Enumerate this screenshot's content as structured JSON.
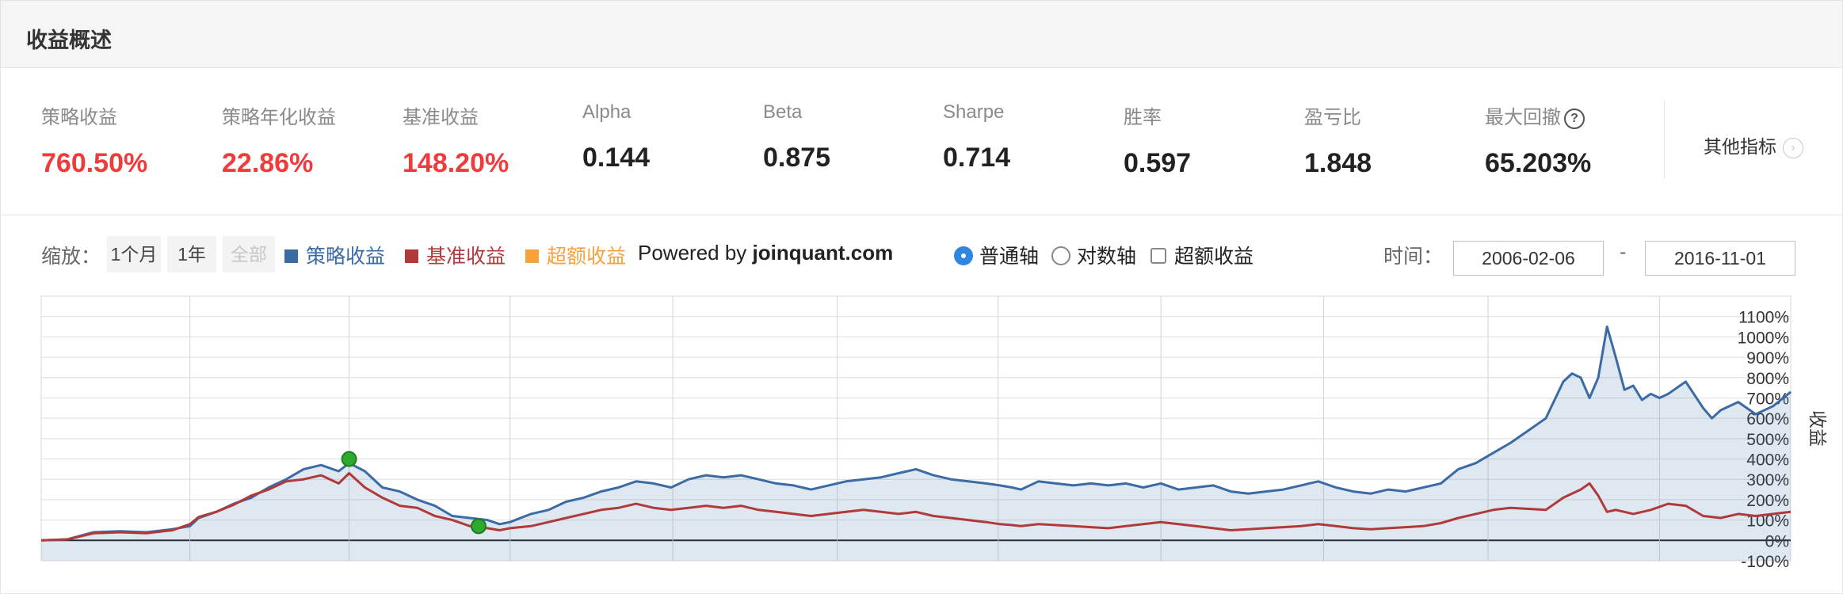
{
  "header": {
    "title": "收益概述"
  },
  "stats": [
    {
      "label": "策略收益",
      "value": "760.50%",
      "color": "red"
    },
    {
      "label": "策略年化收益",
      "value": "22.86%",
      "color": "red"
    },
    {
      "label": "基准收益",
      "value": "148.20%",
      "color": "red"
    },
    {
      "label": "Alpha",
      "value": "0.144",
      "color": "dark"
    },
    {
      "label": "Beta",
      "value": "0.875",
      "color": "dark"
    },
    {
      "label": "Sharpe",
      "value": "0.714",
      "color": "dark"
    },
    {
      "label": "胜率",
      "value": "0.597",
      "color": "dark"
    },
    {
      "label": "盈亏比",
      "value": "1.848",
      "color": "dark"
    },
    {
      "label": "最大回撤",
      "value": "65.203%",
      "color": "dark",
      "icon": "question-icon"
    }
  ],
  "more_metrics": {
    "label": "其他指标",
    "icon": "chevron-right-icon"
  },
  "toolbar": {
    "zoom_label": "缩放：",
    "zoom_buttons": [
      {
        "label": "1个月",
        "enabled": true
      },
      {
        "label": "1年",
        "enabled": true
      },
      {
        "label": "全部",
        "enabled": false
      }
    ],
    "legend": [
      {
        "label": "策略收益",
        "color": "#3b6ba5"
      },
      {
        "label": "基准收益",
        "color": "#b03a3a"
      },
      {
        "label": "超额收益",
        "color": "#f7a13a"
      }
    ],
    "powered_prefix": "Powered by",
    "powered_site": "joinquant.com",
    "axis_options": [
      {
        "label": "普通轴",
        "type": "radio",
        "checked": true
      },
      {
        "label": "对数轴",
        "type": "radio",
        "checked": false
      },
      {
        "label": "超额收益",
        "type": "checkbox",
        "checked": false
      }
    ],
    "time_label": "时间：",
    "date_from": "2006-02-06",
    "date_separator": "-",
    "date_to": "2016-11-01"
  },
  "chart_data": {
    "type": "area",
    "x_range": [
      "2006-02-06",
      "2016-11-01"
    ],
    "ylabel": "收益",
    "y_ticks": [
      "1100%",
      "1000%",
      "900%",
      "800%",
      "700%",
      "600%",
      "500%",
      "400%",
      "300%",
      "200%",
      "100%",
      "0%",
      "-100%"
    ],
    "ylim": [
      -100,
      1200
    ],
    "grid": true,
    "x_markers": [
      0.085,
      0.176,
      0.268,
      0.361,
      0.455,
      0.547,
      0.64,
      0.733,
      0.827,
      0.925
    ],
    "series": [
      {
        "name": "策略收益",
        "color": "#3b6ba5",
        "fill": true,
        "points": [
          [
            0,
            0
          ],
          [
            0.015,
            5
          ],
          [
            0.03,
            40
          ],
          [
            0.045,
            45
          ],
          [
            0.06,
            40
          ],
          [
            0.075,
            55
          ],
          [
            0.085,
            70
          ],
          [
            0.09,
            110
          ],
          [
            0.1,
            140
          ],
          [
            0.11,
            180
          ],
          [
            0.12,
            210
          ],
          [
            0.13,
            260
          ],
          [
            0.14,
            300
          ],
          [
            0.15,
            350
          ],
          [
            0.16,
            370
          ],
          [
            0.17,
            340
          ],
          [
            0.176,
            380
          ],
          [
            0.185,
            340
          ],
          [
            0.195,
            260
          ],
          [
            0.205,
            240
          ],
          [
            0.215,
            200
          ],
          [
            0.225,
            170
          ],
          [
            0.235,
            120
          ],
          [
            0.245,
            110
          ],
          [
            0.255,
            100
          ],
          [
            0.262,
            80
          ],
          [
            0.268,
            90
          ],
          [
            0.28,
            130
          ],
          [
            0.29,
            150
          ],
          [
            0.3,
            190
          ],
          [
            0.31,
            210
          ],
          [
            0.32,
            240
          ],
          [
            0.33,
            260
          ],
          [
            0.34,
            290
          ],
          [
            0.35,
            280
          ],
          [
            0.36,
            260
          ],
          [
            0.37,
            300
          ],
          [
            0.38,
            320
          ],
          [
            0.39,
            310
          ],
          [
            0.4,
            320
          ],
          [
            0.41,
            300
          ],
          [
            0.42,
            280
          ],
          [
            0.43,
            270
          ],
          [
            0.44,
            250
          ],
          [
            0.45,
            270
          ],
          [
            0.46,
            290
          ],
          [
            0.47,
            300
          ],
          [
            0.48,
            310
          ],
          [
            0.49,
            330
          ],
          [
            0.5,
            350
          ],
          [
            0.51,
            320
          ],
          [
            0.52,
            300
          ],
          [
            0.53,
            290
          ],
          [
            0.54,
            280
          ],
          [
            0.548,
            270
          ],
          [
            0.555,
            260
          ],
          [
            0.56,
            250
          ],
          [
            0.57,
            290
          ],
          [
            0.58,
            280
          ],
          [
            0.59,
            270
          ],
          [
            0.6,
            280
          ],
          [
            0.61,
            270
          ],
          [
            0.62,
            280
          ],
          [
            0.63,
            260
          ],
          [
            0.64,
            280
          ],
          [
            0.65,
            250
          ],
          [
            0.66,
            260
          ],
          [
            0.67,
            270
          ],
          [
            0.68,
            240
          ],
          [
            0.69,
            230
          ],
          [
            0.7,
            240
          ],
          [
            0.71,
            250
          ],
          [
            0.72,
            270
          ],
          [
            0.73,
            290
          ],
          [
            0.74,
            260
          ],
          [
            0.75,
            240
          ],
          [
            0.76,
            230
          ],
          [
            0.77,
            250
          ],
          [
            0.78,
            240
          ],
          [
            0.79,
            260
          ],
          [
            0.8,
            280
          ],
          [
            0.81,
            350
          ],
          [
            0.82,
            380
          ],
          [
            0.83,
            430
          ],
          [
            0.84,
            480
          ],
          [
            0.85,
            540
          ],
          [
            0.86,
            600
          ],
          [
            0.87,
            780
          ],
          [
            0.875,
            820
          ],
          [
            0.88,
            800
          ],
          [
            0.885,
            700
          ],
          [
            0.89,
            800
          ],
          [
            0.895,
            1050
          ],
          [
            0.9,
            900
          ],
          [
            0.905,
            740
          ],
          [
            0.91,
            760
          ],
          [
            0.915,
            690
          ],
          [
            0.92,
            720
          ],
          [
            0.925,
            700
          ],
          [
            0.93,
            720
          ],
          [
            0.94,
            780
          ],
          [
            0.95,
            650
          ],
          [
            0.955,
            600
          ],
          [
            0.96,
            640
          ],
          [
            0.97,
            680
          ],
          [
            0.98,
            620
          ],
          [
            0.99,
            660
          ],
          [
            1.0,
            730
          ]
        ]
      },
      {
        "name": "基准收益",
        "color": "#b03a3a",
        "fill": false,
        "points": [
          [
            0,
            0
          ],
          [
            0.015,
            5
          ],
          [
            0.03,
            35
          ],
          [
            0.045,
            40
          ],
          [
            0.06,
            35
          ],
          [
            0.075,
            50
          ],
          [
            0.085,
            80
          ],
          [
            0.09,
            115
          ],
          [
            0.1,
            140
          ],
          [
            0.11,
            175
          ],
          [
            0.12,
            220
          ],
          [
            0.13,
            250
          ],
          [
            0.14,
            290
          ],
          [
            0.15,
            300
          ],
          [
            0.16,
            320
          ],
          [
            0.17,
            280
          ],
          [
            0.176,
            330
          ],
          [
            0.185,
            260
          ],
          [
            0.195,
            210
          ],
          [
            0.205,
            170
          ],
          [
            0.215,
            160
          ],
          [
            0.225,
            120
          ],
          [
            0.235,
            100
          ],
          [
            0.245,
            70
          ],
          [
            0.255,
            60
          ],
          [
            0.262,
            50
          ],
          [
            0.268,
            60
          ],
          [
            0.28,
            70
          ],
          [
            0.29,
            90
          ],
          [
            0.3,
            110
          ],
          [
            0.31,
            130
          ],
          [
            0.32,
            150
          ],
          [
            0.33,
            160
          ],
          [
            0.34,
            180
          ],
          [
            0.35,
            160
          ],
          [
            0.36,
            150
          ],
          [
            0.37,
            160
          ],
          [
            0.38,
            170
          ],
          [
            0.39,
            160
          ],
          [
            0.4,
            170
          ],
          [
            0.41,
            150
          ],
          [
            0.42,
            140
          ],
          [
            0.43,
            130
          ],
          [
            0.44,
            120
          ],
          [
            0.45,
            130
          ],
          [
            0.46,
            140
          ],
          [
            0.47,
            150
          ],
          [
            0.48,
            140
          ],
          [
            0.49,
            130
          ],
          [
            0.5,
            140
          ],
          [
            0.51,
            120
          ],
          [
            0.52,
            110
          ],
          [
            0.53,
            100
          ],
          [
            0.54,
            90
          ],
          [
            0.548,
            80
          ],
          [
            0.555,
            75
          ],
          [
            0.56,
            70
          ],
          [
            0.57,
            80
          ],
          [
            0.58,
            75
          ],
          [
            0.59,
            70
          ],
          [
            0.6,
            65
          ],
          [
            0.61,
            60
          ],
          [
            0.62,
            70
          ],
          [
            0.63,
            80
          ],
          [
            0.64,
            90
          ],
          [
            0.65,
            80
          ],
          [
            0.66,
            70
          ],
          [
            0.67,
            60
          ],
          [
            0.68,
            50
          ],
          [
            0.69,
            55
          ],
          [
            0.7,
            60
          ],
          [
            0.71,
            65
          ],
          [
            0.72,
            70
          ],
          [
            0.73,
            80
          ],
          [
            0.74,
            70
          ],
          [
            0.75,
            60
          ],
          [
            0.76,
            55
          ],
          [
            0.77,
            60
          ],
          [
            0.78,
            65
          ],
          [
            0.79,
            70
          ],
          [
            0.8,
            85
          ],
          [
            0.81,
            110
          ],
          [
            0.82,
            130
          ],
          [
            0.83,
            150
          ],
          [
            0.84,
            160
          ],
          [
            0.85,
            155
          ],
          [
            0.86,
            150
          ],
          [
            0.87,
            210
          ],
          [
            0.88,
            250
          ],
          [
            0.885,
            280
          ],
          [
            0.89,
            220
          ],
          [
            0.895,
            140
          ],
          [
            0.9,
            150
          ],
          [
            0.91,
            130
          ],
          [
            0.92,
            150
          ],
          [
            0.93,
            180
          ],
          [
            0.94,
            170
          ],
          [
            0.95,
            120
          ],
          [
            0.96,
            110
          ],
          [
            0.97,
            130
          ],
          [
            0.98,
            120
          ],
          [
            0.99,
            130
          ],
          [
            1.0,
            140
          ]
        ]
      }
    ],
    "markers": [
      {
        "x": 0.176,
        "y": 400,
        "color": "#2ea82e"
      },
      {
        "x": 0.25,
        "y": 70,
        "color": "#2ea82e"
      }
    ]
  }
}
